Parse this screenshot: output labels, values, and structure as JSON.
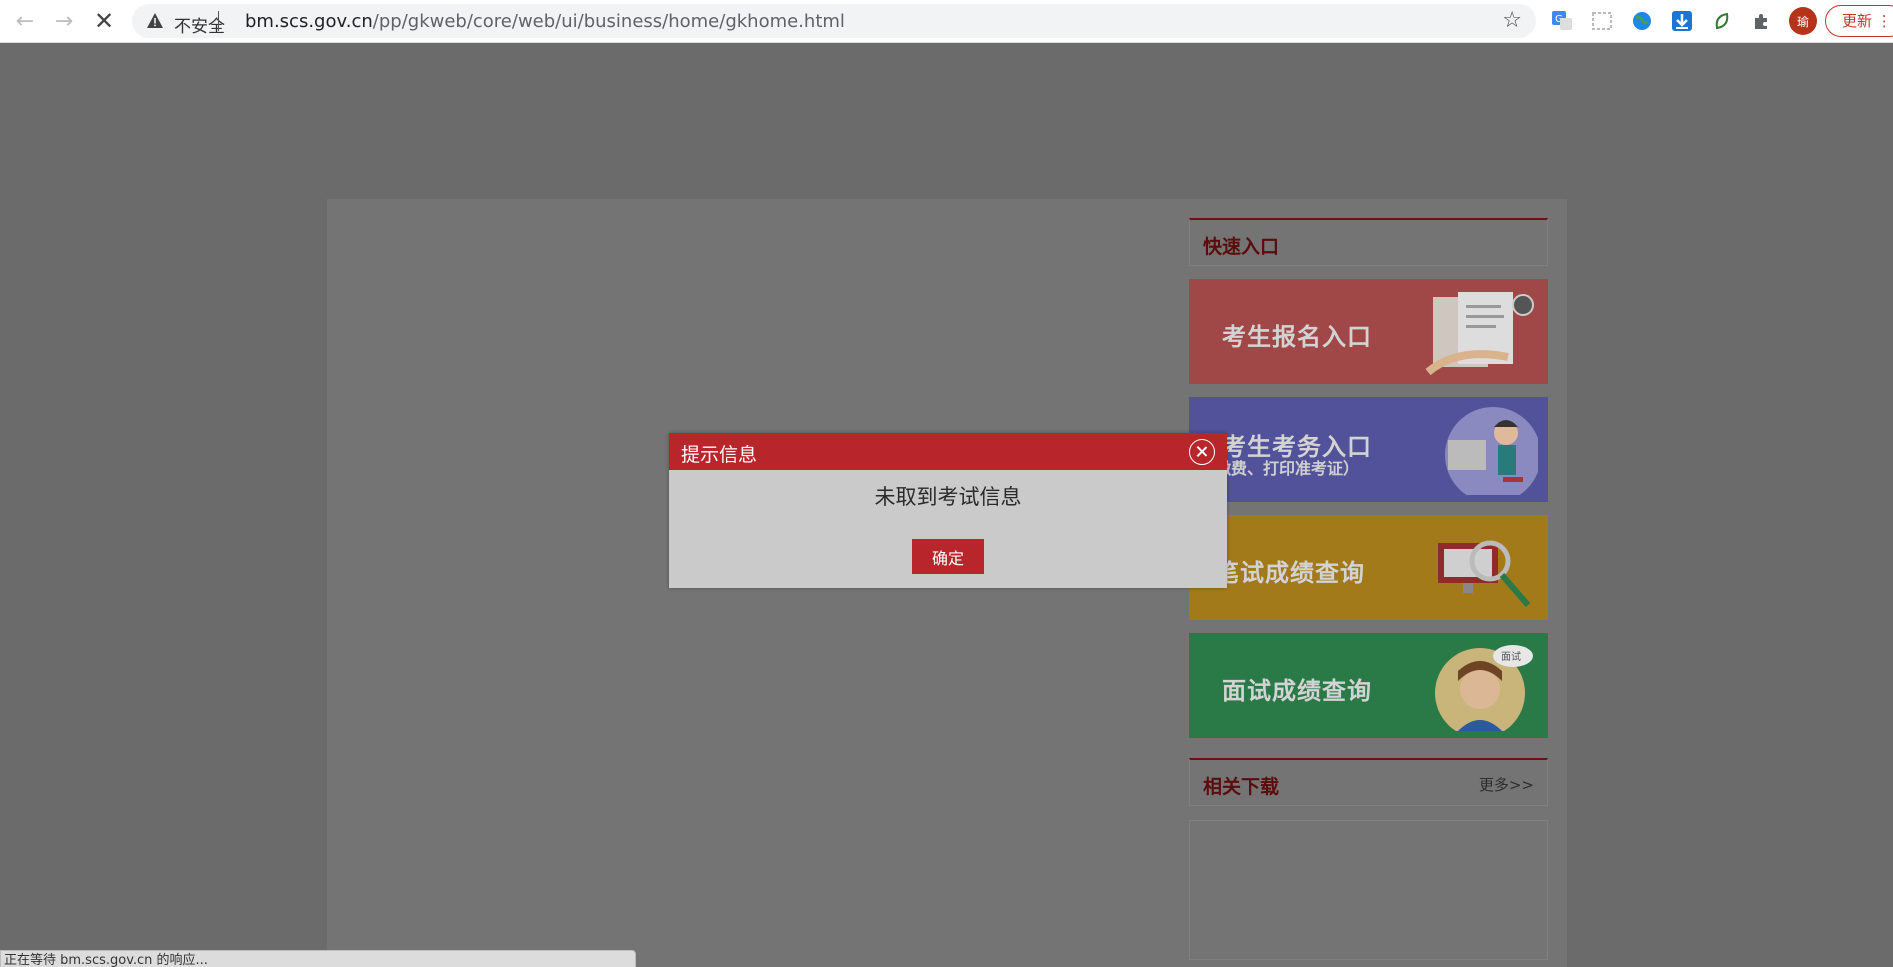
{
  "browser": {
    "security_label": "不安全",
    "url_host": "bm.scs.gov.cn",
    "url_path": "/pp/gkweb/core/web/ui/business/home/gkhome.html",
    "avatar_letter": "瑜",
    "update_label": "更新"
  },
  "quick_entry": {
    "title": "快速入口",
    "cards": [
      {
        "label": "考生报名入口",
        "sub": "",
        "color": "#a04848"
      },
      {
        "label": "考生考务入口",
        "sub": "缴费、打印准考证）",
        "color": "#52529a"
      },
      {
        "label": "笔试成绩查询",
        "sub": "",
        "color": "#a37a1a"
      },
      {
        "label": "面试成绩查询",
        "sub": "",
        "color": "#2a7a47"
      }
    ]
  },
  "downloads": {
    "title": "相关下载",
    "more_label": "更多>>"
  },
  "dialog": {
    "title": "提示信息",
    "message": "未取到考试信息",
    "ok_label": "确定"
  },
  "status_bar": {
    "text": "正在等待 bm.scs.gov.cn 的响应..."
  },
  "colors": {
    "accent_red": "#b8262b",
    "overlay": "#6b6b6b"
  }
}
